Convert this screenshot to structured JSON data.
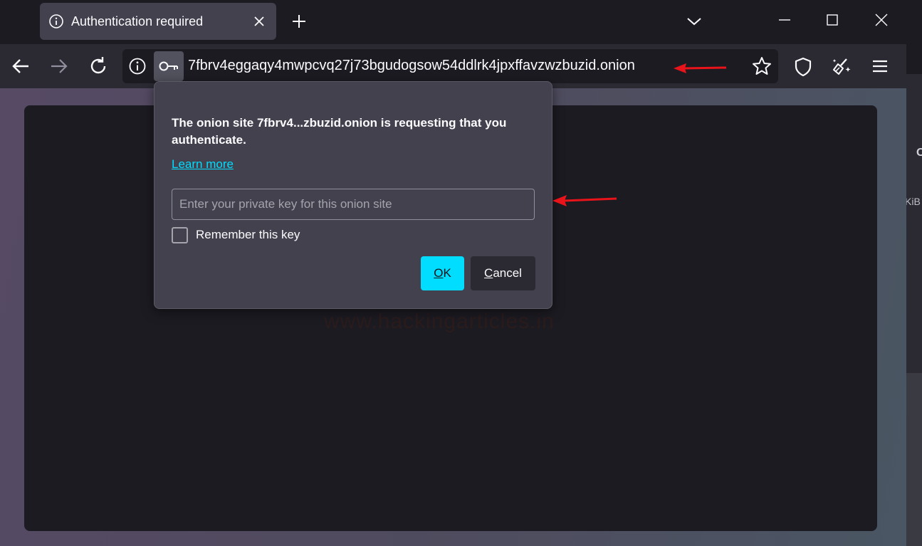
{
  "tab": {
    "title": "Authentication required",
    "icon": "info-icon"
  },
  "navbar": {
    "url": "7fbrv4eggaqy4mwpcvq27j73bgudogsow54ddlrk4jpxffavzwzbuzid.onion"
  },
  "popup": {
    "message": "The onion site 7fbrv4...zbuzid.onion is requesting that you authenticate.",
    "learn_more": "Learn more",
    "key_placeholder": "Enter your private key for this onion site",
    "remember_label": "Remember this key",
    "ok_accel": "O",
    "ok_rest": "K",
    "cancel_accel": "C",
    "cancel_rest": "ancel"
  },
  "page": {
    "watermark": "www.hackingarticles.in"
  },
  "edge": {
    "kib": "KiB"
  },
  "colors": {
    "accent": "#00ddff",
    "annotation_arrow": "#e8141a"
  }
}
